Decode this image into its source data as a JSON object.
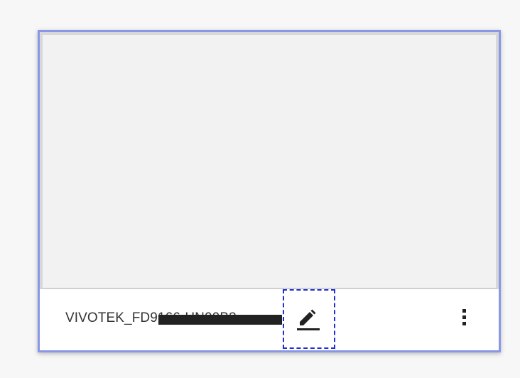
{
  "card": {
    "camera_name": "VIVOTEK_FD9166-HN00B3",
    "preview_state": "empty"
  },
  "icons": {
    "edit": "pencil-icon",
    "more": "more-vertical-icon"
  },
  "colors": {
    "card_border": "#8a97e6",
    "focus_outline": "#1f2fd0"
  }
}
